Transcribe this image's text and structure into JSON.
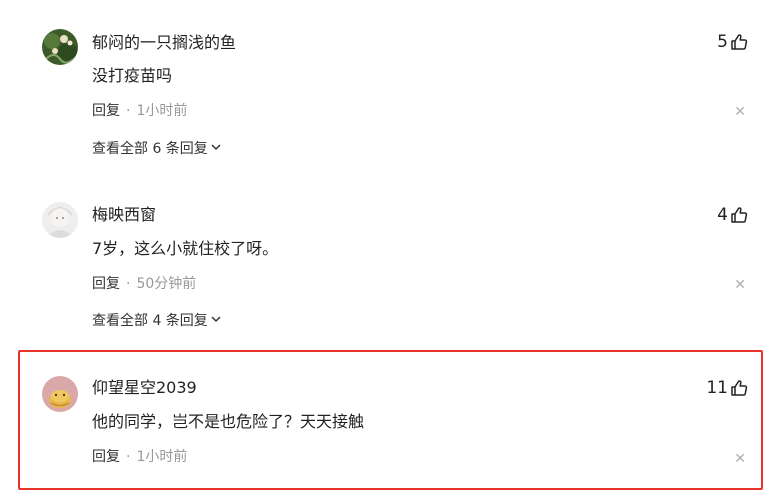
{
  "comments": [
    {
      "username": "郁闷的一只搁浅的鱼",
      "likes": "5",
      "content": "没打疫苗吗",
      "reply_label": "回复",
      "separator": "·",
      "time": "1小时前",
      "view_all": "查看全部 6 条回复",
      "avatar_colors": [
        "#3c5a2a",
        "#8aa86a",
        "#e8e0c0"
      ]
    },
    {
      "username": "梅映西窗",
      "likes": "4",
      "content": "7岁，这么小就住校了呀。",
      "reply_label": "回复",
      "separator": "·",
      "time": "50分钟前",
      "view_all": "查看全部 4 条回复",
      "avatar_colors": [
        "#e4e4e4",
        "#cfcfcf",
        "#f4f2f0"
      ]
    },
    {
      "username": "仰望星空2039",
      "likes": "11",
      "content": "他的同学，岂不是也危险了？天天接触",
      "reply_label": "回复",
      "separator": "·",
      "time": "1小时前",
      "avatar_colors": [
        "#d9a8a8",
        "#e8b84a",
        "#c48a3a"
      ]
    }
  ],
  "icons": {
    "like": "thumbs-up-icon",
    "close": "close-icon",
    "chevron": "chevron-down-icon"
  },
  "highlight_color": "#e8322d"
}
